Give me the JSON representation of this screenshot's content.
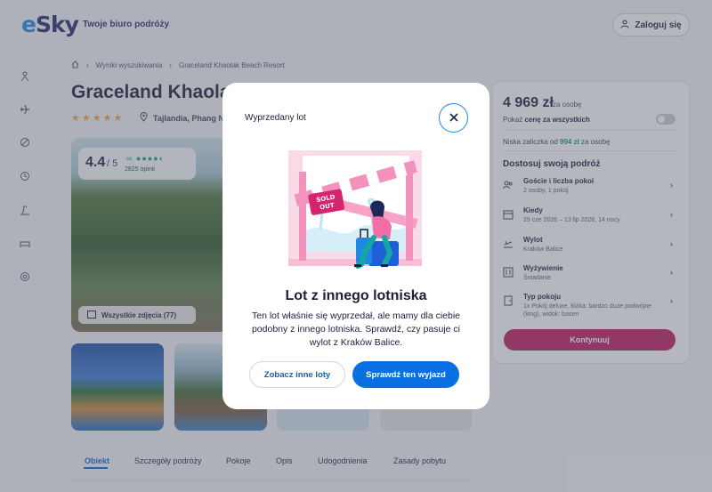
{
  "header": {
    "logo": "eSky",
    "tagline": "Twoje biuro podróży",
    "login_label": "Zaloguj się"
  },
  "sidebar": {
    "icons": [
      "activities-icon",
      "flight-icon",
      "deals-icon",
      "history-icon",
      "vacation-icon",
      "hotel-icon",
      "help-icon"
    ]
  },
  "breadcrumb": {
    "items": [
      "Wyniki wyszukiwania",
      "Graceland Khaolak Beach Resort"
    ]
  },
  "hotel": {
    "title": "Graceland Khaolak B",
    "stars": "★★★★★",
    "location": "Tajlandia, Phang N",
    "rating": "4.4",
    "rating_scale": "/ 5",
    "reviews": "2825 opinii",
    "all_photos": "Wszystkie zdjęcia (77)"
  },
  "tabs": [
    "Obiekt",
    "Szczegóły podróży",
    "Pokoje",
    "Opis",
    "Udogodnienia",
    "Zasady pobytu"
  ],
  "booking": {
    "price": "4 969 zł",
    "price_unit": "za osobę",
    "show_total_prefix": "Pokaż ",
    "show_total_bold": "cenę za wszystkich",
    "deposit_prefix": "Niska zaliczka od ",
    "deposit_value": "994 zł",
    "deposit_suffix": " za osobę",
    "customize_title": "Dostosuj swoją podróż",
    "options": [
      {
        "title": "Goście i liczba pokoi",
        "sub": "2 osoby, 1 pokój"
      },
      {
        "title": "Kiedy",
        "sub": "29 cze 2026 – 13 lip 2026, 14 nocy"
      },
      {
        "title": "Wylot",
        "sub": "Kraków Balice"
      },
      {
        "title": "Wyżywienie",
        "sub": "Śniadanie"
      },
      {
        "title": "Typ pokoju",
        "sub": "1x Pokój deluxe, łóżka: bardzo duże podwójne (king), widok: basen"
      }
    ],
    "continue_label": "Kontynuuj"
  },
  "modal": {
    "title": "Wyprzedany lot",
    "sold_out_badge": "SOLD OUT",
    "heading": "Lot z innego lotniska",
    "body": "Ten lot właśnie się wyprzedał, ale mamy dla ciebie podobny z innego lotniska. Sprawdź, czy pasuje ci wylot z Kraków Balice.",
    "btn_other": "Zobacz inne loty",
    "btn_check": "Sprawdź ten wyjazd"
  },
  "colors": {
    "brand_blue": "#0a6fe0",
    "brand_magenta": "#c0185c",
    "deposit_green": "#13a05c",
    "star": "#f2a33a"
  }
}
